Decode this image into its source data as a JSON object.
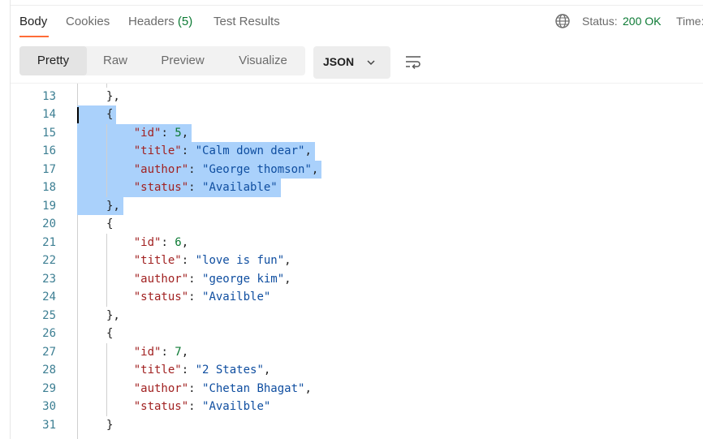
{
  "tabs": [
    {
      "label": "Body",
      "active": true
    },
    {
      "label": "Cookies"
    },
    {
      "label": "Headers",
      "count": "(5)"
    },
    {
      "label": "Test Results"
    }
  ],
  "status": {
    "label": "Status:",
    "value": "200 OK",
    "time_label": "Time:"
  },
  "view_modes": [
    {
      "label": "Pretty",
      "active": true
    },
    {
      "label": "Raw"
    },
    {
      "label": "Preview"
    },
    {
      "label": "Visualize"
    }
  ],
  "format": {
    "label": "JSON"
  },
  "editor": {
    "selected_lines": [
      14,
      19
    ],
    "lines": [
      {
        "n": "13",
        "text": "},"
      },
      {
        "n": "14",
        "text": "{"
      },
      {
        "n": "15",
        "key": "\"id\"",
        "num": "5"
      },
      {
        "n": "16",
        "key": "\"title\"",
        "str": "\"Calm down dear\""
      },
      {
        "n": "17",
        "key": "\"author\"",
        "str": "\"George thomson\""
      },
      {
        "n": "18",
        "key": "\"status\"",
        "str": "\"Available\"",
        "last": true
      },
      {
        "n": "19",
        "text": "},"
      },
      {
        "n": "20",
        "text": "{"
      },
      {
        "n": "21",
        "key": "\"id\"",
        "num": "6"
      },
      {
        "n": "22",
        "key": "\"title\"",
        "str": "\"love is fun\""
      },
      {
        "n": "23",
        "key": "\"author\"",
        "str": "\"george kim\""
      },
      {
        "n": "24",
        "key": "\"status\"",
        "str": "\"Availble\"",
        "last": true
      },
      {
        "n": "25",
        "text": "},"
      },
      {
        "n": "26",
        "text": "{"
      },
      {
        "n": "27",
        "key": "\"id\"",
        "num": "7"
      },
      {
        "n": "28",
        "key": "\"title\"",
        "str": "\"2 States\""
      },
      {
        "n": "29",
        "key": "\"author\"",
        "str": "\"Chetan Bhagat\""
      },
      {
        "n": "30",
        "key": "\"status\"",
        "str": "\"Availble\"",
        "last": true
      },
      {
        "n": "31",
        "text": "}"
      }
    ]
  },
  "colors": {
    "accent": "#ff6c37",
    "status_ok": "#0c7a34",
    "selection": "#aad1fb",
    "json_key": "#a12121",
    "json_string": "#0f4ea0",
    "json_number": "#0c7a34",
    "line_number": "#3d7f93"
  },
  "icons": {
    "globe": "globe-icon",
    "chevron": "chevron-down-icon",
    "wrap": "wrap-lines-icon"
  }
}
